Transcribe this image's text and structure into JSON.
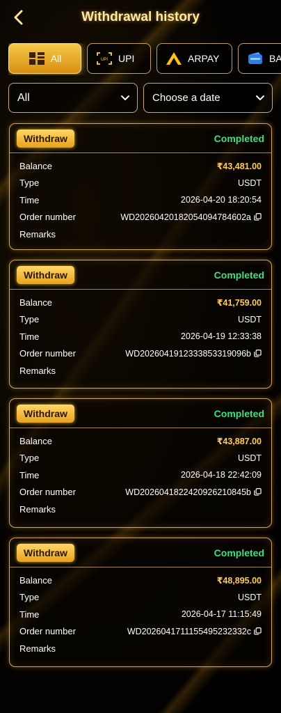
{
  "header": {
    "title": "Withdrawal history"
  },
  "tabs": [
    {
      "label": "All",
      "icon": "grid-icon"
    },
    {
      "label": "UPI",
      "icon": "upi-icon"
    },
    {
      "label": "ARPAY",
      "icon": "arpay-icon"
    },
    {
      "label": "BA",
      "icon": "bank-icon"
    }
  ],
  "filters": {
    "status_value": "All",
    "date_placeholder": "Choose a date"
  },
  "labels": {
    "balance": "Balance",
    "type": "Type",
    "time": "Time",
    "order": "Order number",
    "remarks": "Remarks"
  },
  "records": [
    {
      "badge": "Withdraw",
      "status": "Completed",
      "balance": "₹43,481.00",
      "type": "USDT",
      "time": "2026-04-20 18:20:54",
      "order": "WD2026042018205409478​4602a",
      "remarks": ""
    },
    {
      "badge": "Withdraw",
      "status": "Completed",
      "balance": "₹41,759.00",
      "type": "USDT",
      "time": "2026-04-19 12:33:38",
      "order": "WD2026041912333853319096b",
      "remarks": ""
    },
    {
      "badge": "Withdraw",
      "status": "Completed",
      "balance": "₹43,887.00",
      "type": "USDT",
      "time": "2026-04-18 22:42:09",
      "order": "WD2026041822420926210845b",
      "remarks": ""
    },
    {
      "badge": "Withdraw",
      "status": "Completed",
      "balance": "₹48,895.00",
      "type": "USDT",
      "time": "2026-04-17 11:15:49",
      "order": "WD2026041711155495232332c",
      "remarks": ""
    }
  ],
  "colors": {
    "accent": "#f7c84a",
    "status_green": "#3ee080",
    "amount_gold": "#ffcc5a"
  }
}
